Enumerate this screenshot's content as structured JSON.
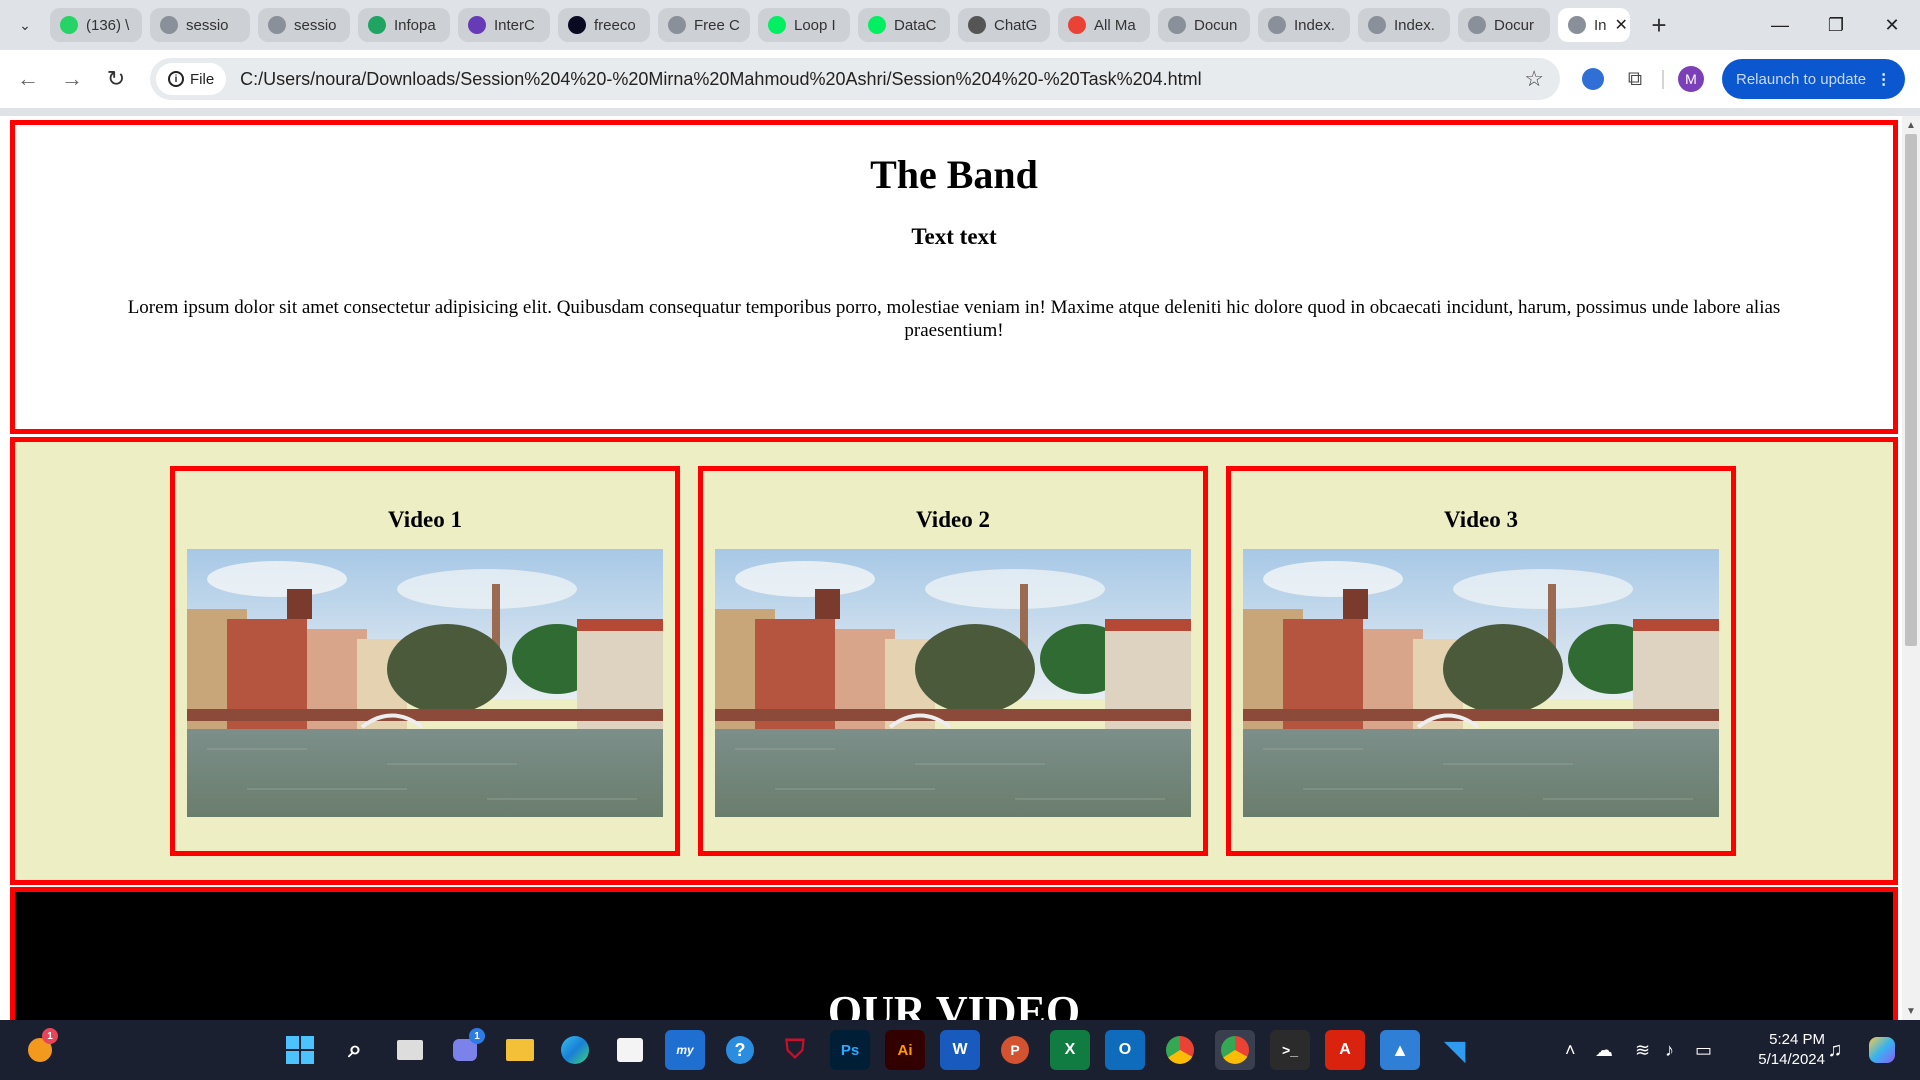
{
  "browser": {
    "tabs": [
      {
        "label": "(136) \\",
        "icon": "whatsapp-icon",
        "color": "#25d366"
      },
      {
        "label": "sessio",
        "icon": "globe-icon",
        "color": "#8a9099"
      },
      {
        "label": "sessio",
        "icon": "globe-icon",
        "color": "#8a9099"
      },
      {
        "label": "Infopa",
        "icon": "google-drive-icon",
        "color": "#1fa463"
      },
      {
        "label": "InterC",
        "icon": "forms-icon",
        "color": "#673ab7"
      },
      {
        "label": "freeco",
        "icon": "freecodecamp-icon",
        "color": "#0a0a23"
      },
      {
        "label": "Free C",
        "icon": "globe-icon",
        "color": "#8a9099"
      },
      {
        "label": "Loop I",
        "icon": "datacamp-icon",
        "color": "#03ef62"
      },
      {
        "label": "DataC",
        "icon": "datacamp-icon",
        "color": "#03ef62"
      },
      {
        "label": "ChatG",
        "icon": "chatgpt-icon",
        "color": "#555555"
      },
      {
        "label": "All Ma",
        "icon": "gmail-icon",
        "color": "#ea4335"
      },
      {
        "label": "Docun",
        "icon": "globe-icon",
        "color": "#8a9099"
      },
      {
        "label": "Index.",
        "icon": "globe-icon",
        "color": "#8a9099"
      },
      {
        "label": "Index.",
        "icon": "globe-icon",
        "color": "#8a9099"
      },
      {
        "label": "Docur",
        "icon": "globe-icon",
        "color": "#8a9099"
      }
    ],
    "active_tab": {
      "label": "In",
      "close": "✕"
    },
    "new_tab": "+",
    "scheme_chip": "File",
    "url": "C:/Users/noura/Downloads/Session%204%20-%20Mirna%20Mahmoud%20Ashri/Session%204%20-%20Task%204.html",
    "avatar_letter": "M",
    "relaunch_label": "Relaunch to update"
  },
  "page": {
    "title": "The Band",
    "subtitle": "Text text",
    "paragraph": "Lorem ipsum dolor sit amet consectetur adipisicing elit. Quibusdam consequatur temporibus porro, molestiae veniam in! Maxime atque deleniti hic dolore quod in obcaecati incidunt, harum, possimus unde labore alias praesentium!",
    "videos": [
      {
        "title": "Video 1"
      },
      {
        "title": "Video 2"
      },
      {
        "title": "Video 3"
      }
    ],
    "section_heading": "OUR VIDEO"
  },
  "colors": {
    "border": "#ff0000",
    "videos_bg": "#eeeec4",
    "footer_bg": "#000000"
  },
  "taskbar": {
    "time": "5:24 PM",
    "date": "5/14/2024",
    "notification_badge": "1",
    "teams_badge": "1"
  }
}
